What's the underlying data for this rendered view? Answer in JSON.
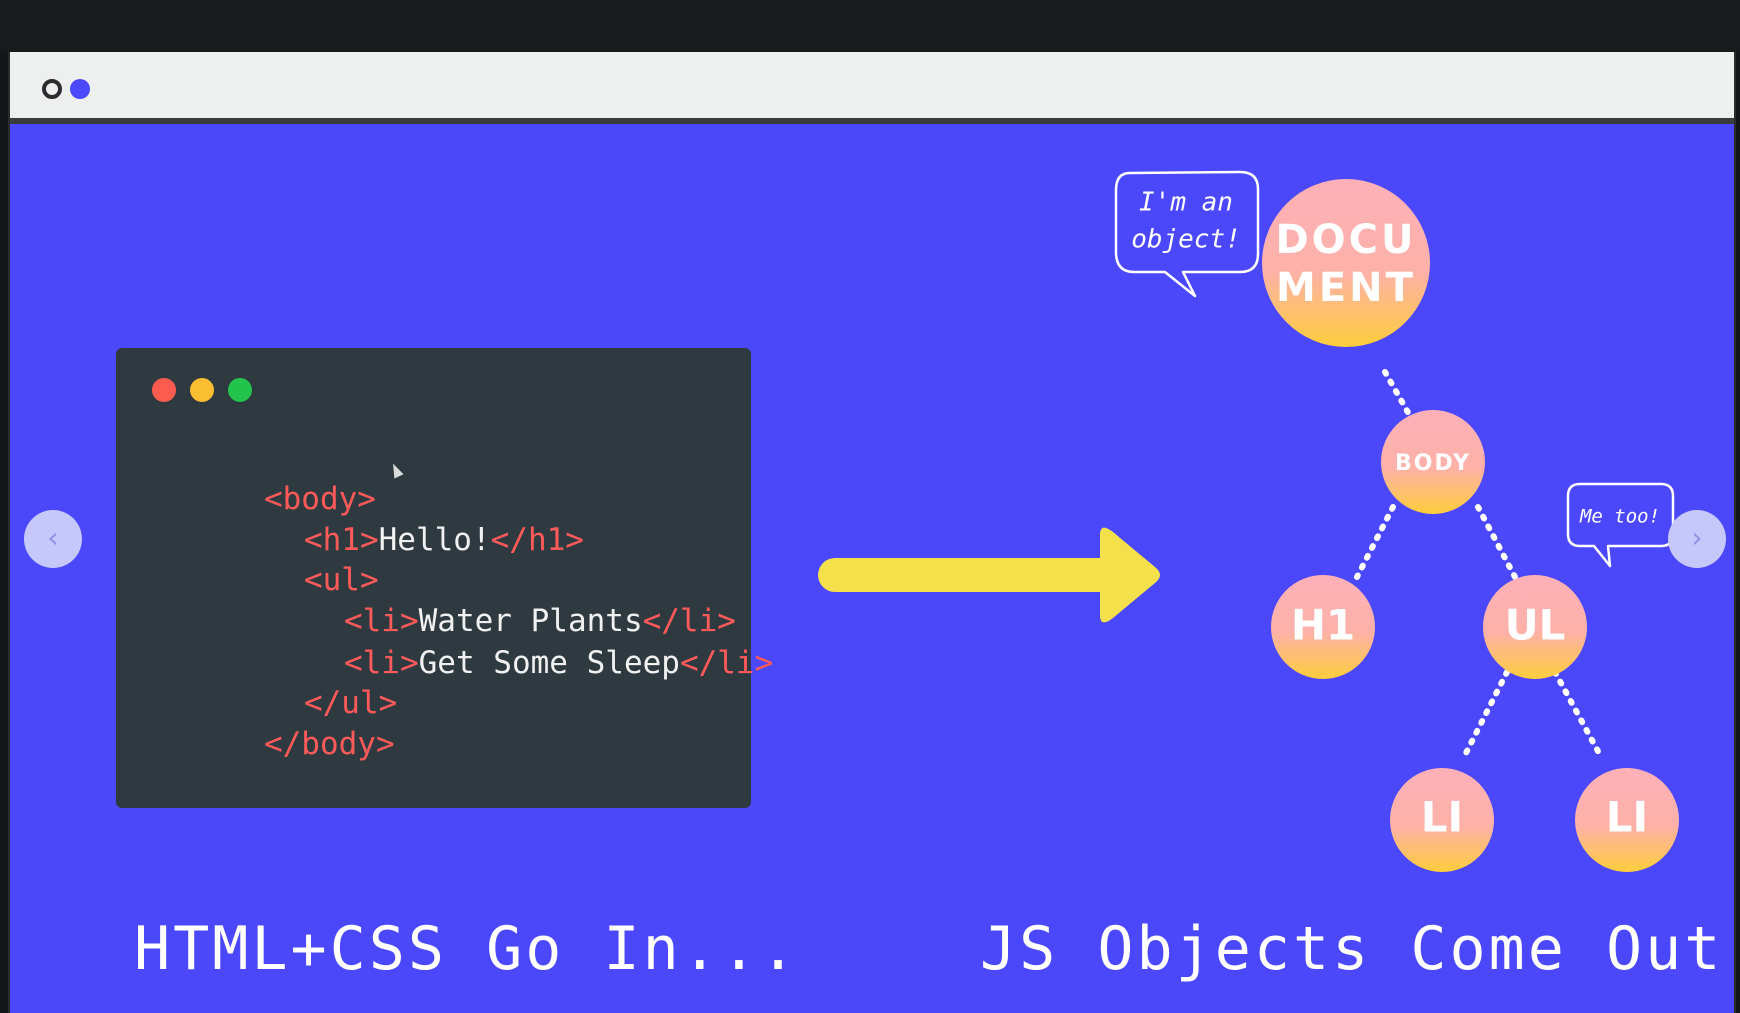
{
  "browser": {
    "dots": [
      "outline-dot",
      "filled-dot"
    ]
  },
  "code_window": {
    "buttons": [
      "close",
      "minimize",
      "maximize"
    ],
    "lines": [
      {
        "parts": [
          {
            "cls": "tag",
            "text": "<body>"
          }
        ]
      },
      {
        "parts": [
          {
            "cls": "tag",
            "text": "<h1>"
          },
          {
            "cls": "txt",
            "text": "Hello!"
          },
          {
            "cls": "tag",
            "text": "</h1>"
          }
        ]
      },
      {
        "parts": [
          {
            "cls": "tag",
            "text": "<ul>"
          }
        ]
      },
      {
        "parts": [
          {
            "cls": "tag",
            "text": "<li>"
          },
          {
            "cls": "txt",
            "text": "Water Plants"
          },
          {
            "cls": "tag",
            "text": "</li>"
          }
        ]
      },
      {
        "parts": [
          {
            "cls": "tag",
            "text": "<li>"
          },
          {
            "cls": "txt",
            "text": "Get Some Sleep"
          },
          {
            "cls": "tag",
            "text": "</li>"
          }
        ]
      },
      {
        "parts": [
          {
            "cls": "tag",
            "text": "</ul>"
          }
        ]
      },
      {
        "parts": [
          {
            "cls": "tag",
            "text": "</body>"
          }
        ]
      }
    ]
  },
  "tree": {
    "nodes": {
      "document": [
        "DOCU",
        "MENT"
      ],
      "body": "BODY",
      "h1": "H1",
      "ul": "UL",
      "li_left": "LI",
      "li_right": "LI"
    },
    "bubbles": {
      "document": [
        "I'm an",
        "object!"
      ],
      "ul": "Me too!"
    }
  },
  "captions": {
    "left": "HTML+CSS Go In...",
    "right": "JS Objects Come Out"
  },
  "nav": {
    "prev": "‹",
    "next": "›"
  },
  "colors": {
    "slide_bg": "#4b48fb",
    "code_bg": "#2f3a40",
    "tag": "#ff5a5a",
    "arrow": "#f3e04b",
    "node_top": "#fdb1b8",
    "node_bottom": "#fdcd3c"
  }
}
